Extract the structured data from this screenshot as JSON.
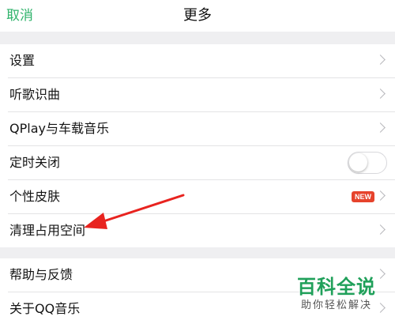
{
  "header": {
    "cancel_label": "取消",
    "title": "更多"
  },
  "menu_group_1": {
    "items": [
      {
        "label": "设置",
        "accessory": "chevron"
      },
      {
        "label": "听歌识曲",
        "accessory": "chevron"
      },
      {
        "label": "QPlay与车载音乐",
        "accessory": "chevron"
      },
      {
        "label": "定时关闭",
        "accessory": "toggle",
        "toggle_on": false
      },
      {
        "label": "个性皮肤",
        "accessory": "chevron",
        "badge": "NEW"
      },
      {
        "label": "清理占用空间",
        "accessory": "chevron"
      }
    ]
  },
  "menu_group_2": {
    "items": [
      {
        "label": "帮助与反馈",
        "accessory": "chevron"
      },
      {
        "label": "关于QQ音乐",
        "accessory": "chevron"
      }
    ]
  },
  "colors": {
    "accent": "#2fb36b",
    "badge": "#e6432c",
    "annotation_arrow": "#e8231f",
    "background": "#efeff1"
  },
  "watermark": {
    "main": "百科全说",
    "sub": "助你轻松解决"
  }
}
